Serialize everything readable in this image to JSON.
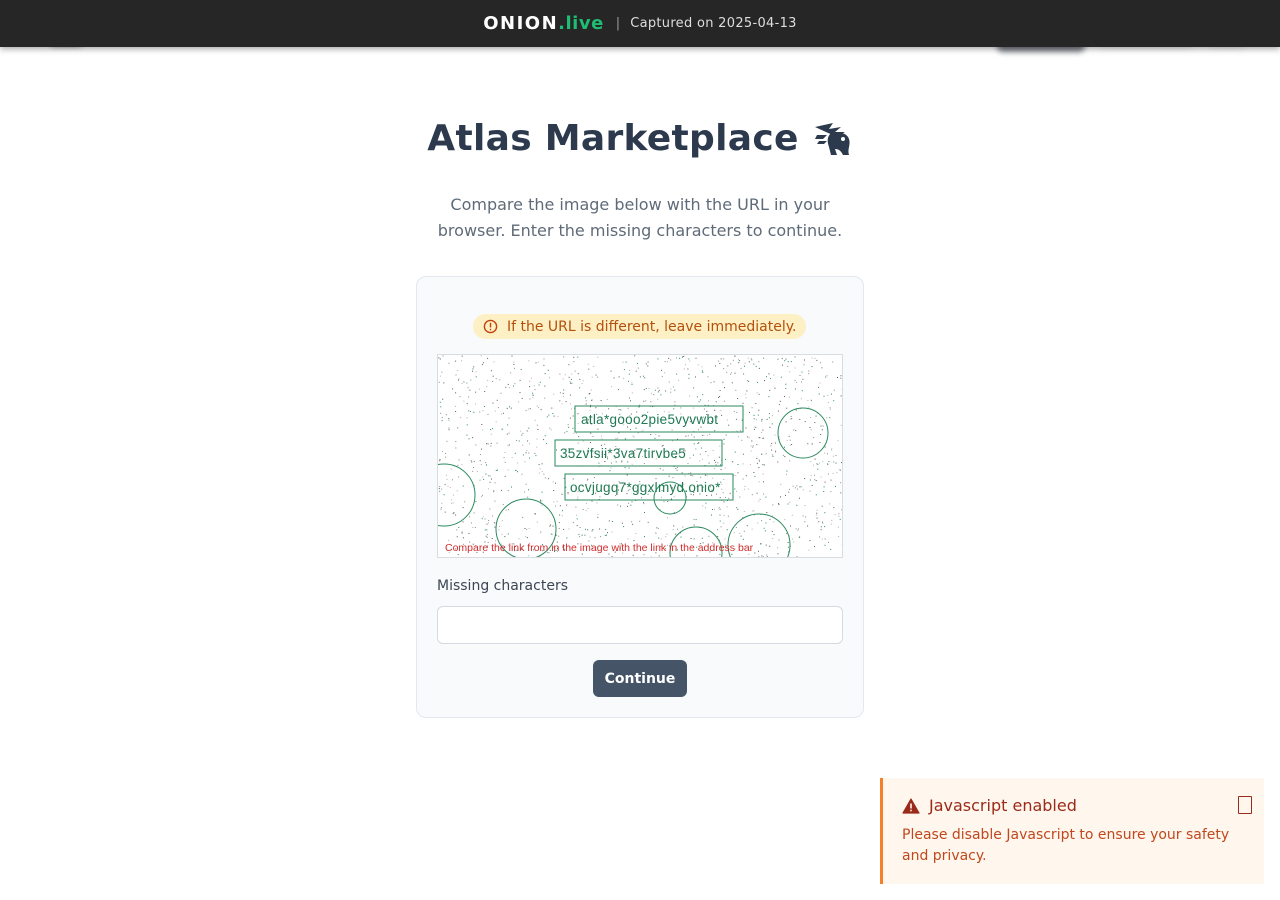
{
  "topbar": {
    "brand_main": "ONION",
    "brand_accent": ".live",
    "separator": "|",
    "capture_text": "Captured on 2025-04-13",
    "accent_color": "#1fbd73"
  },
  "page": {
    "title": "Atlas Marketplace",
    "title_icon": "griffin-logo-icon",
    "subtitle": "Compare the image below with the URL in your browser. Enter the missing characters to continue."
  },
  "card": {
    "warning_icon": "alert-circle-icon",
    "warning_text": "If the URL is different, leave immediately.",
    "captcha": {
      "line1": "atla*gooo2pie5vyvwbt",
      "line2": "35zvfsii*3va7tirvbe5",
      "line3": "ocvjugq7*ggxlmyd.onio*",
      "caption": "Compare the link from in the image with the link in the address bar"
    },
    "field_label": "Missing characters",
    "field_value": "",
    "field_placeholder": "",
    "continue_label": "Continue"
  },
  "js_alert": {
    "icon": "warning-triangle-icon",
    "title": "Javascript enabled",
    "body": "Please disable Javascript to ensure your safety and privacy.",
    "close_icon": "close-icon"
  }
}
